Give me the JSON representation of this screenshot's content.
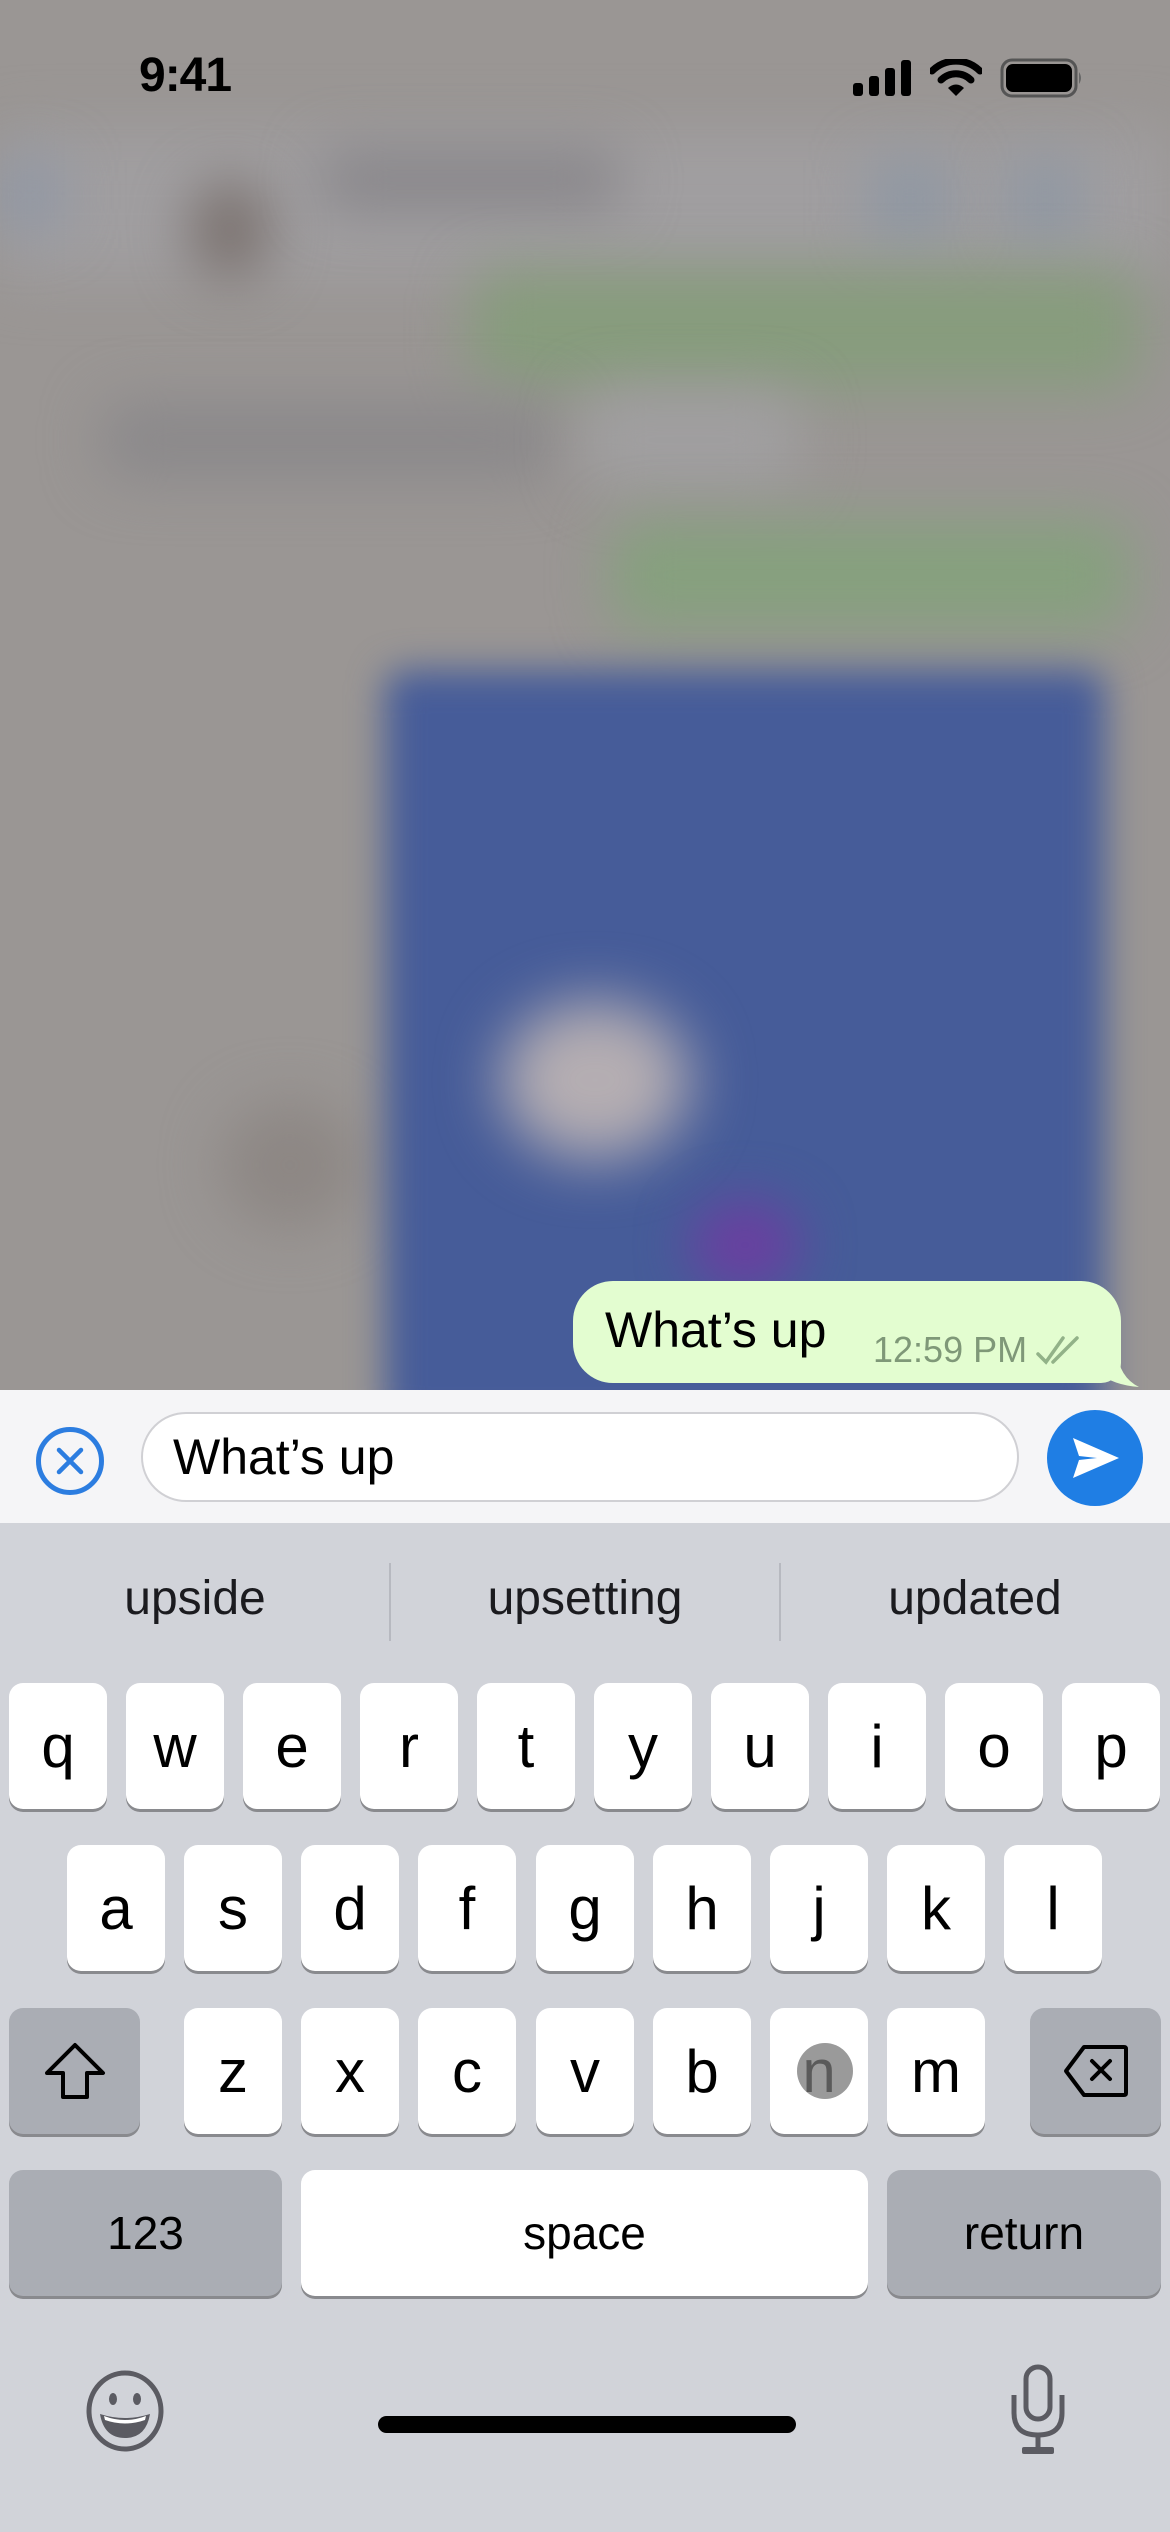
{
  "status_bar": {
    "time": "9:41",
    "icons": [
      "cellular-signal-icon",
      "wifi-icon",
      "battery-icon"
    ]
  },
  "chat": {
    "background_blurred": true,
    "last_message": {
      "text": "What’s up",
      "time": "12:59 PM",
      "status_icon": "double-check-icon",
      "direction": "outgoing",
      "bubble_color": "#e3fdd0"
    }
  },
  "composer": {
    "cancel_icon": "circle-x-icon",
    "input_value": "What’s up",
    "send_icon": "send-arrow-icon",
    "accent_color": "#1f7ee4"
  },
  "keyboard": {
    "suggestions": [
      "upside",
      "upsetting",
      "updated"
    ],
    "rows": [
      [
        "q",
        "w",
        "e",
        "r",
        "t",
        "y",
        "u",
        "i",
        "o",
        "p"
      ],
      [
        "a",
        "s",
        "d",
        "f",
        "g",
        "h",
        "j",
        "k",
        "l"
      ],
      [
        "z",
        "x",
        "c",
        "v",
        "b",
        "n",
        "m"
      ]
    ],
    "shift_icon": "shift-arrow-icon",
    "delete_icon": "backspace-icon",
    "numbers_label": "123",
    "space_label": "space",
    "return_label": "return",
    "emoji_icon": "emoji-smiley-icon",
    "mic_icon": "microphone-icon",
    "touched_key": "n"
  }
}
